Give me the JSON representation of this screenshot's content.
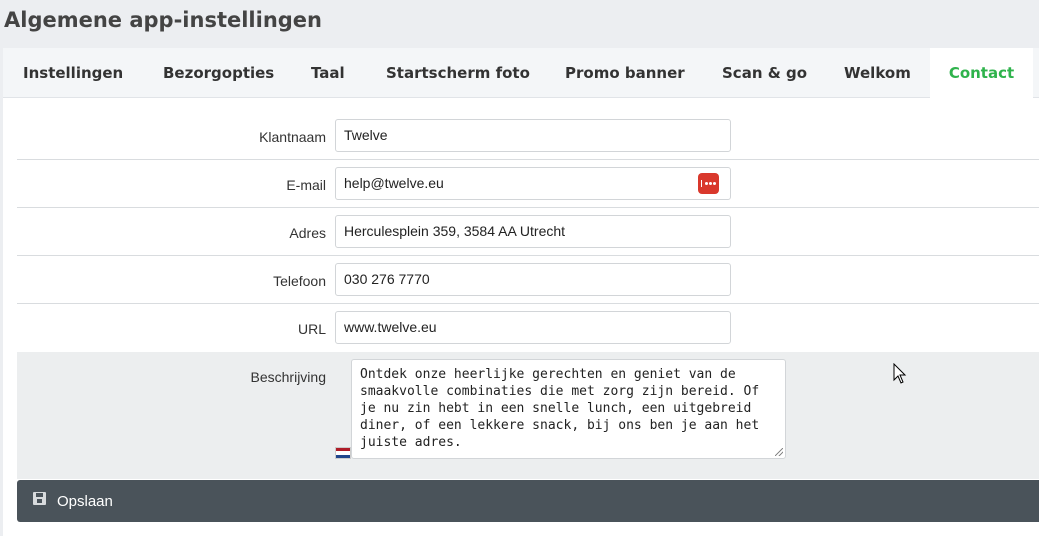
{
  "page_title": "Algemene app-instellingen",
  "tabs": [
    {
      "label": "Instellingen"
    },
    {
      "label": "Bezorgopties"
    },
    {
      "label": "Taal"
    },
    {
      "label": "Startscherm foto"
    },
    {
      "label": "Promo banner"
    },
    {
      "label": "Scan & go"
    },
    {
      "label": "Welkom"
    },
    {
      "label": "Contact",
      "active": true
    }
  ],
  "form": {
    "fields": [
      {
        "label": "Klantnaam",
        "value": "Twelve"
      },
      {
        "label": "E-mail",
        "value": "help@twelve.eu"
      },
      {
        "label": "Adres",
        "value": "Herculesplein 359, 3584 AA Utrecht"
      },
      {
        "label": "Telefoon",
        "value": "030 276 7770"
      },
      {
        "label": "URL",
        "value": "www.twelve.eu"
      }
    ],
    "description": {
      "label": "Beschrijving",
      "value": "Ontdek onze heerlijke gerechten en geniet van de smaakvolle combinaties die met zorg zijn bereid. Of je nu zin hebt in een snelle lunch, een uitgebreid diner, of een lekkere snack, bij ons ben je aan het juiste adres.",
      "language_flag": "dutch-flag-icon"
    }
  },
  "save_button": {
    "label": "Opslaan",
    "icon": "floppy-disk-icon"
  },
  "colors": {
    "active_tab": "#2fb34c",
    "save_bar": "#4a535a",
    "password_icon": "#d9382c"
  }
}
